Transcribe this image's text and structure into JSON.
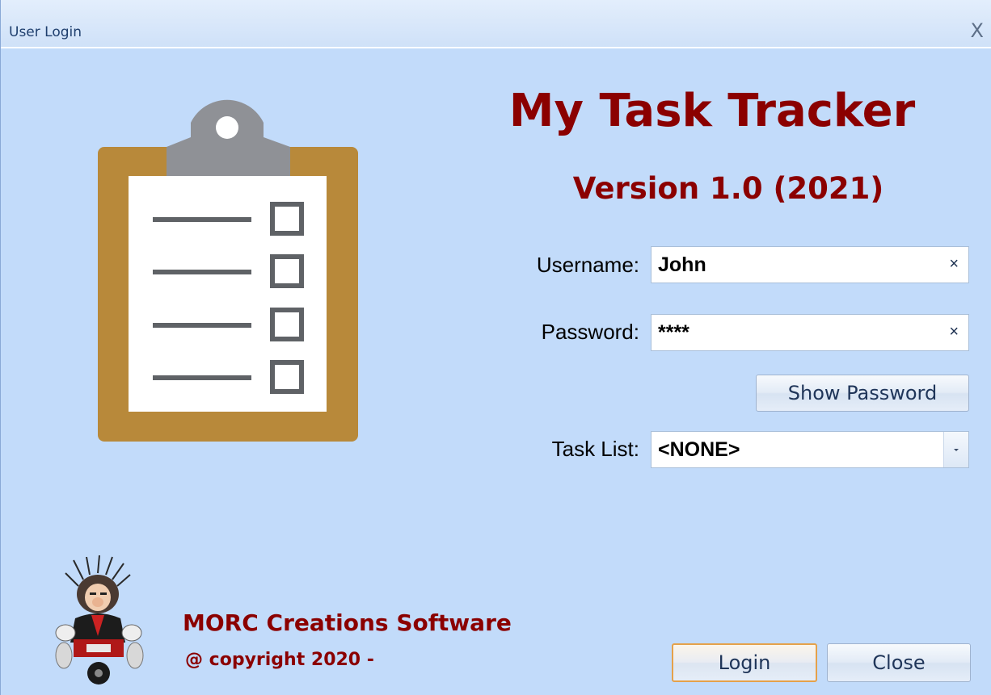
{
  "window": {
    "title": "User Login",
    "close_glyph": "X"
  },
  "app": {
    "name": "My Task Tracker",
    "version": "Version 1.0 (2021)"
  },
  "form": {
    "username": {
      "label": "Username:",
      "value": "John",
      "clear_glyph": "×"
    },
    "password": {
      "label": "Password:",
      "value": "****",
      "clear_glyph": "×"
    },
    "show_password_label": "Show Password",
    "task_list": {
      "label": "Task List:",
      "value": "<NONE>"
    }
  },
  "footer": {
    "company": "MORC Creations Software",
    "copyright": "@ copyright 2020 -",
    "login_label": "Login",
    "close_label": "Close"
  },
  "icons": {
    "logo": "clipboard-checklist-icon",
    "mascot": "biker-mascot-icon"
  },
  "colors": {
    "brand": "#8b0000",
    "background": "#c2dbfa",
    "clipboard_board": "#b8893a",
    "clip": "#8f9196",
    "default_button_border": "#e5a14a"
  }
}
